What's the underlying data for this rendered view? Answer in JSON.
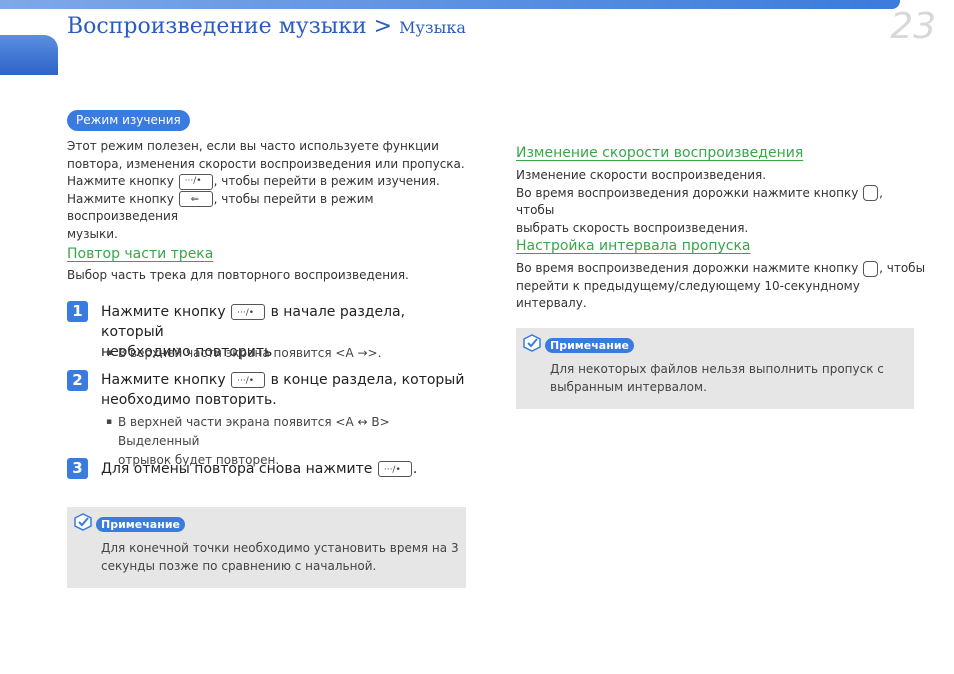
{
  "header": {
    "title": "Воспроизведение музыки > ",
    "subtitle": "Музыка",
    "page_number": "23"
  },
  "left": {
    "badge": "Режим изучения",
    "intro": [
      "Этот режим полезен, если вы часто используете функции",
      "повтора, изменения скорости воспроизведения или пропуска.",
      "Нажмите кнопку ",
      ", чтобы перейти в режим изучения.",
      "Нажмите кнопку ",
      ", чтобы перейти в режим воспроизведения",
      "музыки."
    ],
    "section_title": "Повтор части трека",
    "section_desc": "Выбор часть трека для повторного воспроизведения.",
    "steps": [
      {
        "num": "1",
        "pre": "Нажмите кнопку ",
        "post": " в начале раздела, который",
        "line2": "необходимо повторить",
        "bullet": "В верхней части экрана появится <A →>."
      },
      {
        "num": "2",
        "pre": "Нажмите кнопку ",
        "post": " в конце раздела, который",
        "line2": "необходимо повторить.",
        "bullet": "В верхней части экрана появится <A ↔ B> Выделенный",
        "bullet2": "отрывок будет повторен."
      },
      {
        "num": "3",
        "pre": "Для отмены повтора снова нажмите ",
        "post": "."
      }
    ],
    "note": {
      "label": "Примечание",
      "line1": "Для конечной точки необходимо установить время на 3",
      "line2": "секунды позже по сравнению с начальной."
    }
  },
  "right": {
    "speed_title": "Изменение скорости воспроизведения",
    "speed_line1": "Изменение скорости воспроизведения.",
    "speed_line2_pre": "Во время воспроизведения дорожки нажмите кнопку ",
    "speed_line2_post": ", чтобы",
    "speed_line3": "выбрать скорость воспроизведения.",
    "skip_title": "Настройка интервала пропуска",
    "skip_line1_pre": "Во время воспроизведения дорожки нажмите кнопку ",
    "skip_line1_post": ", чтобы",
    "skip_line2": "перейти к предыдущему/следующему 10-секундному интервалу.",
    "note": {
      "label": "Примечание",
      "line1": "Для некоторых файлов нельзя выполнить пропуск с",
      "line2": "выбранным интервалом."
    }
  },
  "colors": {
    "accent": "#3a7be0",
    "section": "#3aa64a",
    "note_bg": "#e6e6e6"
  }
}
